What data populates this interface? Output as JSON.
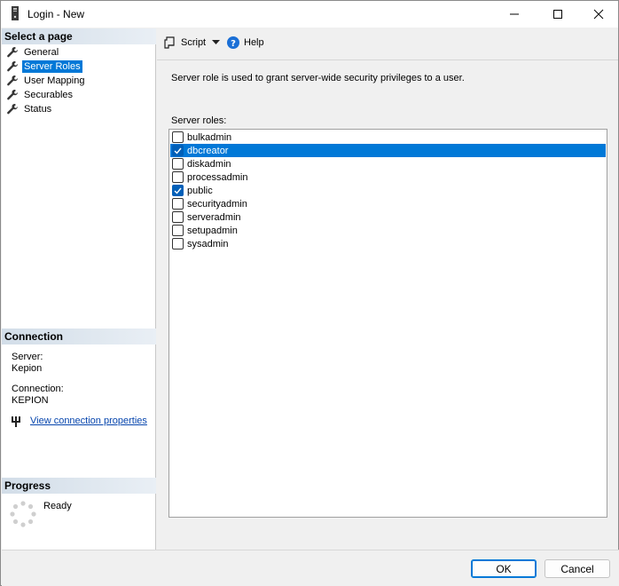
{
  "window": {
    "title": "Login - New"
  },
  "left_panel": {
    "select_page_header": "Select a page",
    "pages": [
      {
        "label": "General",
        "icon": "wrench-icon"
      },
      {
        "label": "Server Roles",
        "icon": "wrench-icon",
        "selected": true
      },
      {
        "label": "User Mapping",
        "icon": "wrench-icon"
      },
      {
        "label": "Securables",
        "icon": "wrench-icon"
      },
      {
        "label": "Status",
        "icon": "wrench-icon"
      }
    ],
    "connection_header": "Connection",
    "server_label": "Server:",
    "server_value": "Kepion",
    "connection_label": "Connection:",
    "connection_value": "KEPION",
    "view_connection_link": "View connection properties",
    "progress_header": "Progress",
    "progress_status": "Ready"
  },
  "toolbar": {
    "script_label": "Script",
    "help_label": "Help"
  },
  "content": {
    "description": "Server role is used to grant server-wide security privileges to a user.",
    "roles_label": "Server roles:",
    "roles": [
      {
        "name": "bulkadmin",
        "checked": false,
        "selected": false
      },
      {
        "name": "dbcreator",
        "checked": true,
        "selected": true
      },
      {
        "name": "diskadmin",
        "checked": false,
        "selected": false
      },
      {
        "name": "processadmin",
        "checked": false,
        "selected": false
      },
      {
        "name": "public",
        "checked": true,
        "selected": false
      },
      {
        "name": "securityadmin",
        "checked": false,
        "selected": false
      },
      {
        "name": "serveradmin",
        "checked": false,
        "selected": false
      },
      {
        "name": "setupadmin",
        "checked": false,
        "selected": false
      },
      {
        "name": "sysadmin",
        "checked": false,
        "selected": false
      }
    ]
  },
  "footer": {
    "ok_label": "OK",
    "cancel_label": "Cancel"
  },
  "colors": {
    "selection": "#0078d7",
    "checkbox_checked": "#005fb8",
    "link": "#0645ad",
    "help_icon": "#1a6fd6"
  }
}
